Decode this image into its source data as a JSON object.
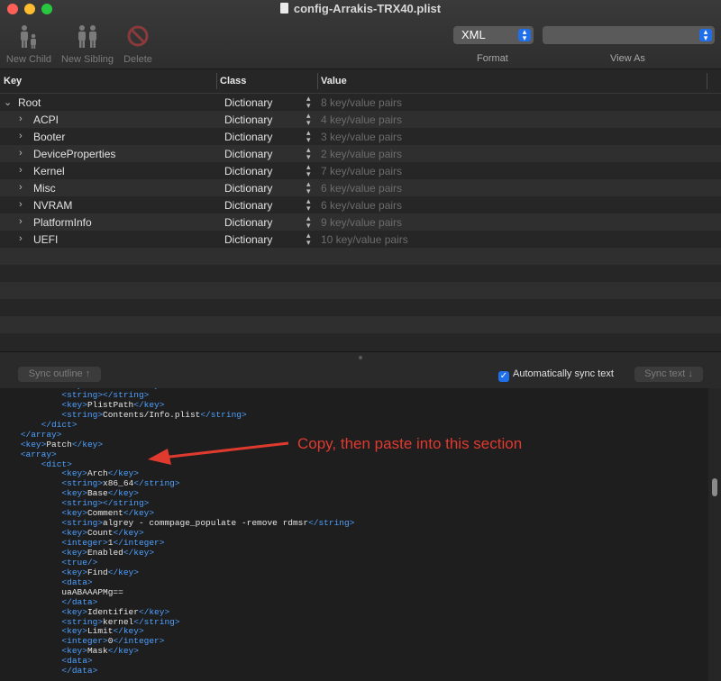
{
  "window": {
    "title": "config-Arrakis-TRX40.plist"
  },
  "colors": {
    "accent": "#1f6feb",
    "annotation": "#e03a2f",
    "xml_tag": "#4ea0ff"
  },
  "toolbar": {
    "new_child": "New Child",
    "new_sibling": "New Sibling",
    "delete": "Delete",
    "format_value": "XML",
    "format_label": "Format",
    "viewas_value": "",
    "viewas_label": "View As"
  },
  "columns": {
    "key": "Key",
    "class": "Class",
    "value": "Value"
  },
  "rows": [
    {
      "key": "Root",
      "class": "Dictionary",
      "value": "8 key/value pairs"
    },
    {
      "key": "ACPI",
      "class": "Dictionary",
      "value": "4 key/value pairs"
    },
    {
      "key": "Booter",
      "class": "Dictionary",
      "value": "3 key/value pairs"
    },
    {
      "key": "DeviceProperties",
      "class": "Dictionary",
      "value": "2 key/value pairs"
    },
    {
      "key": "Kernel",
      "class": "Dictionary",
      "value": "7 key/value pairs"
    },
    {
      "key": "Misc",
      "class": "Dictionary",
      "value": "6 key/value pairs"
    },
    {
      "key": "NVRAM",
      "class": "Dictionary",
      "value": "6 key/value pairs"
    },
    {
      "key": "PlatformInfo",
      "class": "Dictionary",
      "value": "9 key/value pairs"
    },
    {
      "key": "UEFI",
      "class": "Dictionary",
      "value": "10 key/value pairs"
    }
  ],
  "syncbar": {
    "sync_outline": "Sync outline ↑",
    "auto_sync": "Automatically sync text",
    "sync_text": "Sync text ↓"
  },
  "xml_lines": [
    [
      "            ",
      "<key>",
      "MinKernel",
      "</key>"
    ],
    [
      "            ",
      "<string>",
      "",
      "</string>"
    ],
    [
      "            ",
      "<key>",
      "PlistPath",
      "</key>"
    ],
    [
      "            ",
      "<string>",
      "Contents/Info.plist",
      "</string>"
    ],
    [
      "        ",
      "</dict>",
      "",
      ""
    ],
    [
      "    ",
      "</array>",
      "",
      ""
    ],
    [
      "    ",
      "<key>",
      "Patch",
      "</key>"
    ],
    [
      "    ",
      "<array>",
      "",
      ""
    ],
    [
      "        ",
      "<dict>",
      "",
      ""
    ],
    [
      "            ",
      "<key>",
      "Arch",
      "</key>"
    ],
    [
      "            ",
      "<string>",
      "x86_64",
      "</string>"
    ],
    [
      "            ",
      "<key>",
      "Base",
      "</key>"
    ],
    [
      "            ",
      "<string>",
      "",
      "</string>"
    ],
    [
      "            ",
      "<key>",
      "Comment",
      "</key>"
    ],
    [
      "            ",
      "<string>",
      "algrey - commpage_populate -remove rdmsr",
      "</string>"
    ],
    [
      "            ",
      "<key>",
      "Count",
      "</key>"
    ],
    [
      "            ",
      "<integer>",
      "1",
      "</integer>"
    ],
    [
      "            ",
      "<key>",
      "Enabled",
      "</key>"
    ],
    [
      "            ",
      "<true/>",
      "",
      ""
    ],
    [
      "            ",
      "<key>",
      "Find",
      "</key>"
    ],
    [
      "            ",
      "<data>",
      "",
      ""
    ],
    [
      "            ",
      "",
      "uaABAAAPMg==",
      ""
    ],
    [
      "            ",
      "</data>",
      "",
      ""
    ],
    [
      "            ",
      "<key>",
      "Identifier",
      "</key>"
    ],
    [
      "            ",
      "<string>",
      "kernel",
      "</string>"
    ],
    [
      "            ",
      "<key>",
      "Limit",
      "</key>"
    ],
    [
      "            ",
      "<integer>",
      "0",
      "</integer>"
    ],
    [
      "            ",
      "<key>",
      "Mask",
      "</key>"
    ],
    [
      "            ",
      "<data>",
      "",
      ""
    ],
    [
      "            ",
      "</data>",
      "",
      ""
    ]
  ],
  "annotation": {
    "text": "Copy, then paste into this section"
  }
}
